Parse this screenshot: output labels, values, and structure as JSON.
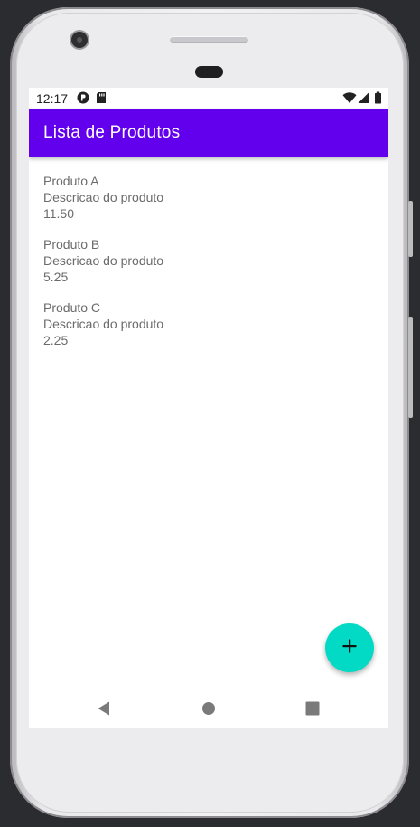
{
  "status_bar": {
    "time": "12:17",
    "icons": [
      "p-circle-icon",
      "sd-card-icon",
      "wifi-icon",
      "signal-icon",
      "battery-icon"
    ]
  },
  "app_bar": {
    "title": "Lista de Produtos",
    "color": "#6200ee"
  },
  "products": [
    {
      "name": "Produto A",
      "description": "Descricao do produto",
      "price": "11.50"
    },
    {
      "name": "Produto B",
      "description": "Descricao do produto",
      "price": "5.25"
    },
    {
      "name": "Produto C",
      "description": "Descricao do produto",
      "price": "2.25"
    }
  ],
  "fab": {
    "icon": "plus-icon",
    "color": "#03dac5"
  },
  "nav_bar": {
    "icons": [
      "back-icon",
      "home-icon",
      "recents-icon"
    ]
  }
}
